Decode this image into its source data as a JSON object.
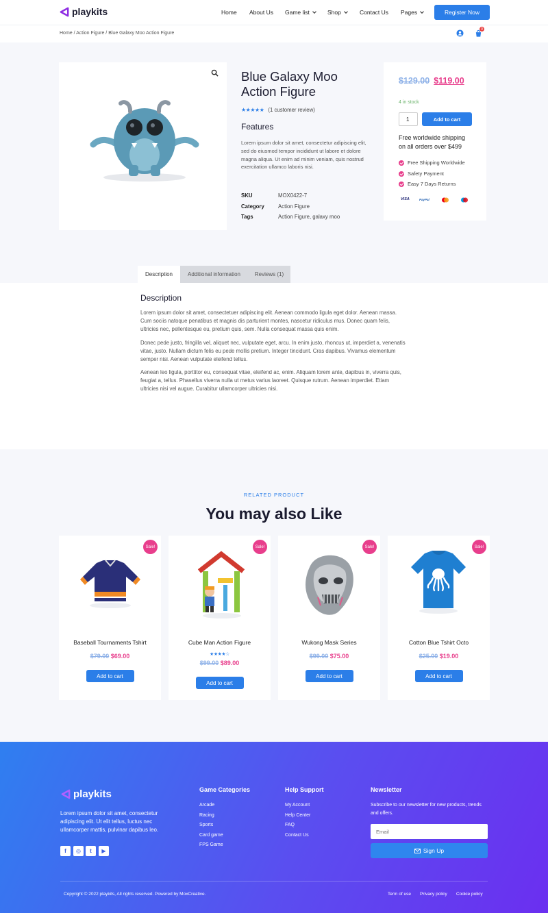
{
  "header": {
    "logo_text": "playkits",
    "nav": [
      "Home",
      "About Us",
      "Game list",
      "Shop",
      "Contact Us",
      "Pages"
    ],
    "cta": "Register Now",
    "cart_count": "0"
  },
  "breadcrumb": "Home / Action Figure / Blue Galaxy Moo Action Figure",
  "product": {
    "title_line1": "Blue Galaxy Moo",
    "title_line2": "Action Figure",
    "stars": "★★★★★",
    "reviews": "(1 customer review)",
    "features_heading": "Features",
    "features_text": "Lorem ipsum dolor sit amet, consectetur adipiscing elit, sed do eiusmod tempor incididunt ut labore et dolore magna aliqua. Ut enim ad minim veniam, quis nostrud exercitation ullamco laboris nisi.",
    "meta": {
      "sku_label": "SKU",
      "sku": "MOX0422-7",
      "category_label": "Category",
      "category": "Action Figure",
      "tags_label": "Tags",
      "tag1": "Action Figure",
      "tag_sep": ",",
      "tag2": "galaxy moo"
    }
  },
  "buybox": {
    "old_price": "$129.00",
    "new_price": "$119.00",
    "stock": "4 in stock",
    "qty": "1",
    "add_to_cart": "Add to cart",
    "shipping_line1": "Free worldwide shipping",
    "shipping_line2": "on all orders over $499",
    "benefits": [
      "Free Shipping Worldwide",
      "Safety Payment",
      "Easy 7 Days Returns"
    ],
    "payments": [
      "VISA",
      "PayPal"
    ]
  },
  "tabs": {
    "items": [
      "Description",
      "Additional information",
      "Reviews (1)"
    ],
    "description_heading": "Description",
    "paragraphs": [
      "Lorem ipsum dolor sit amet, consectetuer adipiscing elit. Aenean commodo ligula eget dolor. Aenean massa. Cum sociis natoque penatibus et magnis dis parturient montes, nascetur ridiculus mus. Donec quam felis, ultricies nec, pellentesque eu, pretium quis, sem. Nulla consequat massa quis enim.",
      "Donec pede justo, fringilla vel, aliquet nec, vulputate eget, arcu. In enim justo, rhoncus ut, imperdiet a, venenatis vitae, justo. Nullam dictum felis eu pede mollis pretium. Integer tincidunt. Cras dapibus. Vivamus elementum semper nisi. Aenean vulputate eleifend tellus.",
      "Aenean leo ligula, porttitor eu, consequat vitae, eleifend ac, enim. Aliquam lorem ante, dapibus in, viverra quis, feugiat a, tellus. Phasellus viverra nulla ut metus varius laoreet. Quisque rutrum. Aenean imperdiet. Etiam ultricies nisi vel augue. Curabitur ullamcorper ultricies nisi."
    ]
  },
  "related": {
    "eyebrow": "RELATED PRODUCT",
    "heading": "You may also Like",
    "sale_label": "Sale!",
    "add_to_cart": "Add to cart",
    "items": [
      {
        "name": "Baseball Tournaments Tshirt",
        "old": "$79.00",
        "new": "$69.00",
        "stars": ""
      },
      {
        "name": "Cube Man Action Figure",
        "old": "$99.00",
        "new": "$89.00",
        "stars": "★★★★☆"
      },
      {
        "name": "Wukong Mask Series",
        "old": "$99.00",
        "new": "$75.00",
        "stars": ""
      },
      {
        "name": "Cotton Blue Tshirt Octo",
        "old": "$25.00",
        "new": "$19.00",
        "stars": ""
      }
    ]
  },
  "footer": {
    "logo_text": "playkits",
    "about": "Lorem ipsum dolor sit amet, consectetur adipiscing elit. Ut elit tellus, luctus nec ullamcorper mattis, pulvinar dapibus leo.",
    "social": [
      "f",
      "◎",
      "t",
      "▶"
    ],
    "categories_heading": "Game Categories",
    "categories": [
      "Arcade",
      "Racing",
      "Sports",
      "Card game",
      "FPS Game"
    ],
    "help_heading": "Help Support",
    "help": [
      "My Account",
      "Help Center",
      "FAQ",
      "Contact Us"
    ],
    "newsletter_heading": "Newsletter",
    "newsletter_text": "Subscribe to our newsletter for new products, trends and offers.",
    "email_placeholder": "Email",
    "signup": "Sign Up",
    "copyright": "Copyright © 2022 playkits, All rights reserved. Powered by MoxCreative.",
    "legal": [
      "Term of use",
      "Privacy policy",
      "Cookie policy"
    ]
  }
}
